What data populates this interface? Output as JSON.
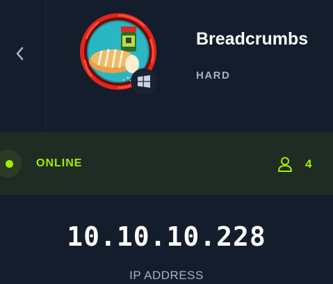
{
  "machine": {
    "name": "Breadcrumbs",
    "difficulty": "HARD",
    "os_icon": "windows-icon",
    "avatar_icon": "breadcrumbs-avatar"
  },
  "status": {
    "label": "ONLINE",
    "player_count": "4",
    "color": "#9fef00"
  },
  "ip": {
    "value": "10.10.10.228",
    "label": "IP ADDRESS"
  },
  "colors": {
    "background": "#141d2b",
    "status_bar": "#1f2c23",
    "accent": "#9fef00",
    "difficulty_ring": "#e3261c",
    "muted_text": "#a4b1cd"
  }
}
